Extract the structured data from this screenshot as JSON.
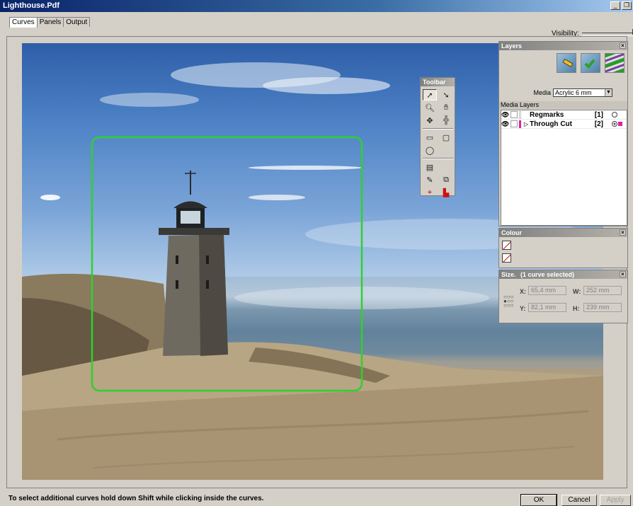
{
  "window": {
    "title": "Lighthouse.Pdf"
  },
  "tabs": [
    {
      "label": "Curves",
      "active": true
    },
    {
      "label": "Panels",
      "active": false
    },
    {
      "label": "Output",
      "active": false
    }
  ],
  "visibility": {
    "label": "Visibility:"
  },
  "layers_panel": {
    "title": "Layers",
    "media_label": "Media",
    "media_value": "Acrylic 6 mm",
    "media_layers_label": "Media Layers",
    "rows": [
      {
        "name": "Regmarks",
        "index": "[1]",
        "color": "#ffffff",
        "selected_marker": false
      },
      {
        "name": "Through Cut",
        "index": "[2]",
        "color": "#e020a0",
        "selected_marker": true
      }
    ]
  },
  "colour_panel": {
    "title": "Colour"
  },
  "size_panel": {
    "title": "Size.",
    "subtitle": "(1 curve selected)",
    "x_label": "X:",
    "x_value": "65,4 mm",
    "y_label": "Y:",
    "y_value": "82,1 mm",
    "w_label": "W:",
    "w_value": "252 mm",
    "h_label": "H:",
    "h_value": "239 mm"
  },
  "toolbar_panel": {
    "title": "Toolbar",
    "tools": [
      "select-icon",
      "direct-select-icon",
      "zoom-icon",
      "hand-icon",
      "move-icon",
      "align-icon",
      "rectangle-icon",
      "rounded-rect-icon",
      "ellipse-icon",
      "weed-icon",
      "curve-icon",
      "copy-icon",
      "regmark-icon",
      "corner-icon"
    ]
  },
  "status": {
    "message": "To select additional curves hold down Shift while clicking inside the curves."
  },
  "buttons": {
    "ok": "OK",
    "cancel": "Cancel",
    "apply": "Apply"
  },
  "colors": {
    "selection": "#2ed12e",
    "title_gradient_start": "#0a246a"
  }
}
